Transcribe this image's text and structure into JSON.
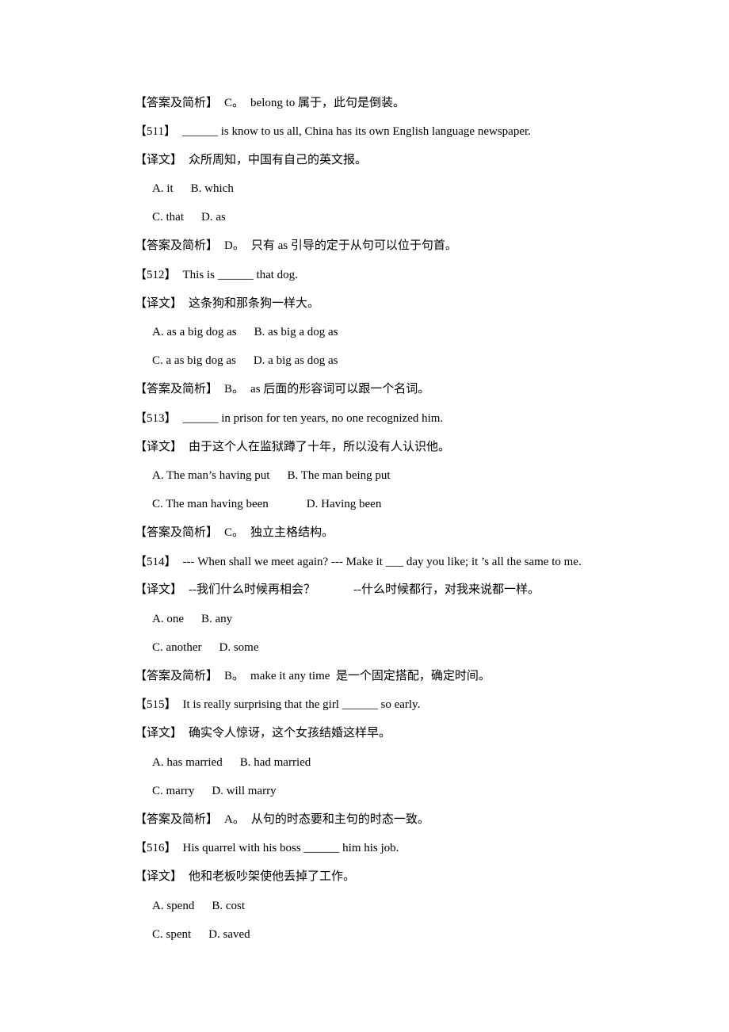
{
  "labels": {
    "answer": "【答案及简析】",
    "translation": "【译文】"
  },
  "lines": {
    "l0": {
      "answer": "C。",
      "text": "belong to 属于，此句是倒装。"
    },
    "q511": {
      "num": "【511】",
      "text": "______ is know to us all, China has its own English language newspaper.",
      "translation": "众所周知，中国有自己的英文报。",
      "opts": [
        "A. it",
        "B. which",
        "C. that",
        "D. as"
      ],
      "answer": "D。",
      "explain": "只有 as 引导的定于从句可以位于句首。"
    },
    "q512": {
      "num": "【512】",
      "text": "This is ______ that dog.",
      "translation": "这条狗和那条狗一样大。",
      "opts": [
        "A. as a big dog as",
        "B. as big a dog as",
        "C. a as big dog as",
        "D. a big as dog as"
      ],
      "answer": "B。",
      "explain": "as 后面的形容词可以跟一个名词。"
    },
    "q513": {
      "num": "【513】",
      "text": "______ in prison for ten years, no one recognized him.",
      "translation": "由于这个人在监狱蹲了十年，所以没有人认识他。",
      "opts": [
        "A. The man’s having put",
        "B. The man being put",
        "C. The man having been",
        "D. Having been"
      ],
      "answer": "C。",
      "explain": "独立主格结构。"
    },
    "q514": {
      "num": "【514】",
      "text": "--- When shall we meet again? --- Make it ___ day you like; it ’s all the same to me.",
      "translation": "--我们什么时候再相会？",
      "translation2": "--什么时候都行，对我来说都一样。",
      "opts": [
        "A. one",
        "B. any",
        "C. another",
        "D. some"
      ],
      "answer": "B。",
      "explain": "make it any time  是一个固定搭配，确定时间。"
    },
    "q515": {
      "num": "【515】",
      "text": "It is really surprising that the girl ______ so early.",
      "translation": "确实令人惊讶，这个女孩结婚这样早。",
      "opts": [
        "A. has married",
        "B. had married",
        "C. marry",
        "D. will marry"
      ],
      "answer": "A。",
      "explain": "从句的时态要和主句的时态一致。"
    },
    "q516": {
      "num": "【516】",
      "text": "His quarrel with his boss ______ him his job.",
      "translation": "他和老板吵架使他丢掉了工作。",
      "opts": [
        "A. spend",
        "B. cost",
        "C. spent",
        "D. saved"
      ]
    }
  }
}
